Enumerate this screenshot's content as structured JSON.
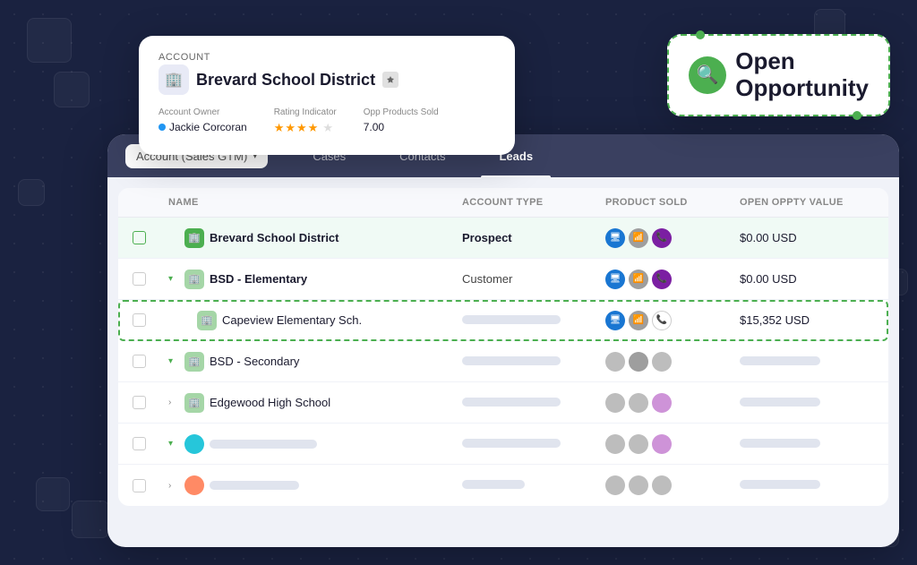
{
  "background": {
    "color": "#1a2240"
  },
  "account_card": {
    "label": "Account",
    "title": "Brevard School District",
    "icon": "🏢",
    "fields": {
      "owner_label": "Account Owner",
      "owner_value": "Jackie Corcoran",
      "rating_label": "Rating Indicator",
      "rating_stars": "★★★★★",
      "opp_label": "Opp Products Sold",
      "opp_value": "7.00"
    }
  },
  "opportunity_badge": {
    "line1": "Open",
    "line2": "Opportunity",
    "icon": "🔍"
  },
  "tabs": {
    "selector_text": "Account",
    "selector_paren": "(Sales GTM)",
    "items": [
      {
        "label": "Cases",
        "active": false
      },
      {
        "label": "Contacts",
        "active": false
      },
      {
        "label": "Leads",
        "active": false
      }
    ]
  },
  "table": {
    "headers": [
      "",
      "Name",
      "Account Type",
      "Product Sold",
      "Open Oppty Value"
    ],
    "rows": [
      {
        "id": "row1",
        "name": "Brevard School District",
        "type": "Prospect",
        "type_bold": true,
        "icon_color": "green",
        "oppty": "$0.00 USD",
        "highlighted": true,
        "has_dashed_border": false
      },
      {
        "id": "row2",
        "name": "BSD - Elementary",
        "type": "Customer",
        "type_bold": false,
        "icon_color": "light-green",
        "oppty": "$0.00 USD",
        "highlighted": false,
        "has_dashed_border": false
      },
      {
        "id": "row3",
        "name": "Capeview Elementary Sch.",
        "type": "skeleton",
        "type_bold": false,
        "icon_color": "light-green",
        "oppty": "$15,352 USD",
        "highlighted": false,
        "has_dashed_border": true
      },
      {
        "id": "row4",
        "name": "BSD - Secondary",
        "type": "skeleton",
        "type_bold": false,
        "icon_color": "light-green",
        "oppty": "skeleton",
        "highlighted": false
      },
      {
        "id": "row5",
        "name": "Edgewood High School",
        "type": "skeleton",
        "type_bold": false,
        "icon_color": "light-green",
        "oppty": "skeleton",
        "highlighted": false
      },
      {
        "id": "row6",
        "name": "teal_avatar",
        "type": "skeleton",
        "oppty": "skeleton"
      },
      {
        "id": "row7",
        "name": "orange_avatar",
        "type": "skeleton",
        "oppty": "skeleton"
      }
    ]
  }
}
